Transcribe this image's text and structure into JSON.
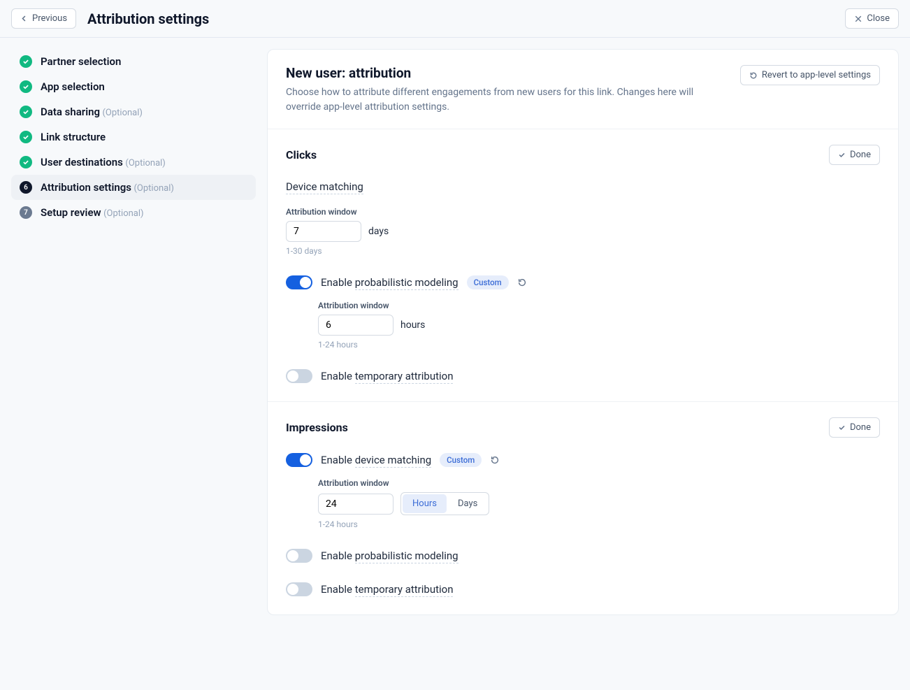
{
  "header": {
    "previous": "Previous",
    "title": "Attribution settings",
    "close": "Close"
  },
  "sidebar": {
    "steps": [
      {
        "label": "Partner selection",
        "optional": ""
      },
      {
        "label": "App selection",
        "optional": ""
      },
      {
        "label": "Data sharing",
        "optional": "(Optional)"
      },
      {
        "label": "Link structure",
        "optional": ""
      },
      {
        "label": "User destinations",
        "optional": "(Optional)"
      },
      {
        "label": "Attribution settings",
        "optional": "(Optional)",
        "num": "6"
      },
      {
        "label": "Setup review",
        "optional": "(Optional)",
        "num": "7"
      }
    ]
  },
  "main": {
    "title": "New user: attribution",
    "desc": "Choose how to attribute different engagements from new users for this link. Changes here will override app-level attribution settings.",
    "revert": "Revert to app-level settings"
  },
  "clicks": {
    "title": "Clicks",
    "done": "Done",
    "device_label": "Device matching",
    "attr_window": "Attribution window",
    "win_value": "7",
    "win_unit": "days",
    "win_hint": "1-30 days",
    "enable_prefix": "Enable ",
    "prob_model": "probabilistic modeling",
    "custom": "Custom",
    "nested_attr_window": "Attribution window",
    "nested_value": "6",
    "nested_unit": "hours",
    "nested_hint": "1-24 hours",
    "temp_attr": "temporary attribution"
  },
  "impressions": {
    "title": "Impressions",
    "done": "Done",
    "enable_prefix": "Enable ",
    "device_match": "device matching",
    "custom": "Custom",
    "attr_window": "Attribution window",
    "win_value": "24",
    "win_hint": "1-24 hours",
    "seg_hours": "Hours",
    "seg_days": "Days",
    "prob_model": "probabilistic modeling",
    "temp_attr": "temporary attribution"
  }
}
